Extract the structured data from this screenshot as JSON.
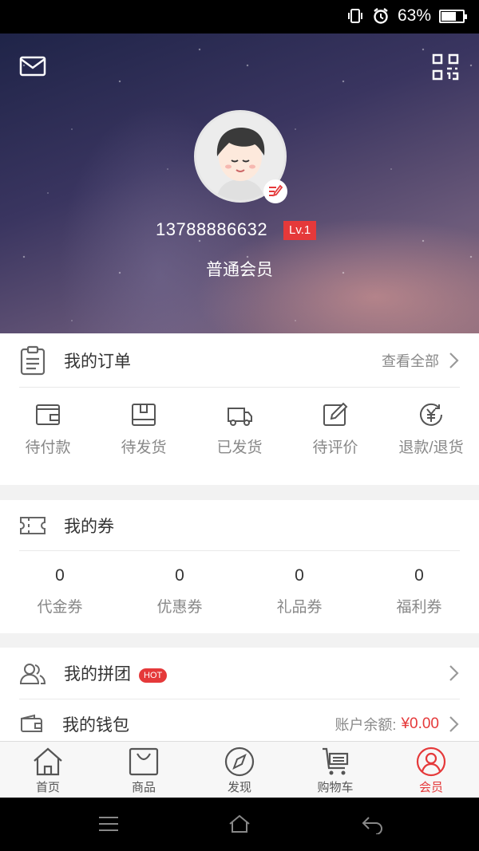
{
  "status_bar": {
    "battery": "63%",
    "battery_level": 0.63
  },
  "profile": {
    "phone": "13788886632",
    "level": "Lv.1",
    "member_type": "普通会员"
  },
  "orders": {
    "title": "我的订单",
    "view_all": "查看全部",
    "items": [
      {
        "label": "待付款",
        "icon": "wallet-icon"
      },
      {
        "label": "待发货",
        "icon": "box-icon"
      },
      {
        "label": "已发货",
        "icon": "truck-icon"
      },
      {
        "label": "待评价",
        "icon": "edit-icon"
      },
      {
        "label": "退款/退货",
        "icon": "refund-icon"
      }
    ]
  },
  "coupons": {
    "title": "我的券",
    "items": [
      {
        "count": "0",
        "label": "代金券"
      },
      {
        "count": "0",
        "label": "优惠券"
      },
      {
        "count": "0",
        "label": "礼品券"
      },
      {
        "count": "0",
        "label": "福利券"
      }
    ]
  },
  "group_buy": {
    "title": "我的拼团",
    "badge": "HOT"
  },
  "wallet": {
    "title": "我的钱包",
    "balance_label": "账户余额:",
    "balance": "¥0.00"
  },
  "tabs": [
    {
      "label": "首页",
      "icon": "home-icon"
    },
    {
      "label": "商品",
      "icon": "bag-icon"
    },
    {
      "label": "发现",
      "icon": "compass-icon"
    },
    {
      "label": "购物车",
      "icon": "cart-icon"
    },
    {
      "label": "会员",
      "icon": "user-icon",
      "active": true
    }
  ],
  "colors": {
    "accent": "#e5393a",
    "muted": "#888888"
  }
}
